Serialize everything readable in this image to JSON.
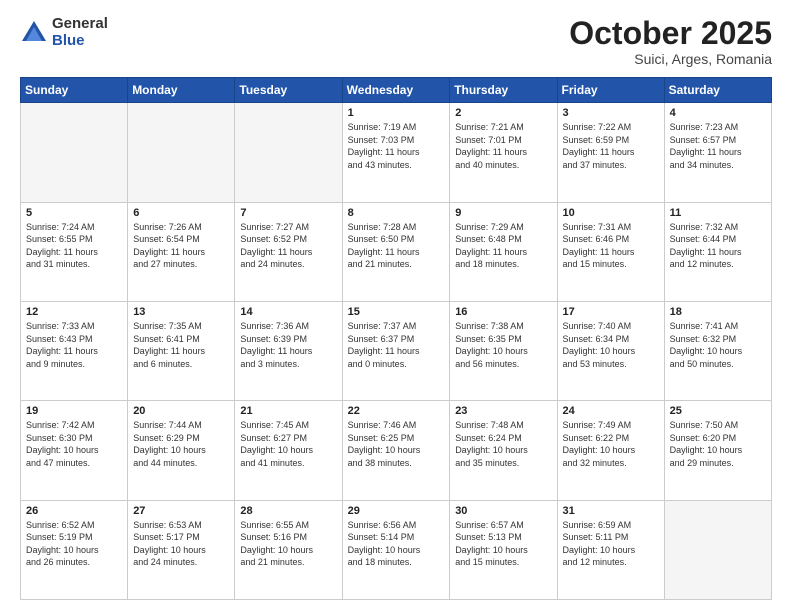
{
  "header": {
    "logo_general": "General",
    "logo_blue": "Blue",
    "month_title": "October 2025",
    "subtitle": "Suici, Arges, Romania"
  },
  "weekdays": [
    "Sunday",
    "Monday",
    "Tuesday",
    "Wednesday",
    "Thursday",
    "Friday",
    "Saturday"
  ],
  "weeks": [
    [
      {
        "day": "",
        "detail": ""
      },
      {
        "day": "",
        "detail": ""
      },
      {
        "day": "",
        "detail": ""
      },
      {
        "day": "1",
        "detail": "Sunrise: 7:19 AM\nSunset: 7:03 PM\nDaylight: 11 hours\nand 43 minutes."
      },
      {
        "day": "2",
        "detail": "Sunrise: 7:21 AM\nSunset: 7:01 PM\nDaylight: 11 hours\nand 40 minutes."
      },
      {
        "day": "3",
        "detail": "Sunrise: 7:22 AM\nSunset: 6:59 PM\nDaylight: 11 hours\nand 37 minutes."
      },
      {
        "day": "4",
        "detail": "Sunrise: 7:23 AM\nSunset: 6:57 PM\nDaylight: 11 hours\nand 34 minutes."
      }
    ],
    [
      {
        "day": "5",
        "detail": "Sunrise: 7:24 AM\nSunset: 6:55 PM\nDaylight: 11 hours\nand 31 minutes."
      },
      {
        "day": "6",
        "detail": "Sunrise: 7:26 AM\nSunset: 6:54 PM\nDaylight: 11 hours\nand 27 minutes."
      },
      {
        "day": "7",
        "detail": "Sunrise: 7:27 AM\nSunset: 6:52 PM\nDaylight: 11 hours\nand 24 minutes."
      },
      {
        "day": "8",
        "detail": "Sunrise: 7:28 AM\nSunset: 6:50 PM\nDaylight: 11 hours\nand 21 minutes."
      },
      {
        "day": "9",
        "detail": "Sunrise: 7:29 AM\nSunset: 6:48 PM\nDaylight: 11 hours\nand 18 minutes."
      },
      {
        "day": "10",
        "detail": "Sunrise: 7:31 AM\nSunset: 6:46 PM\nDaylight: 11 hours\nand 15 minutes."
      },
      {
        "day": "11",
        "detail": "Sunrise: 7:32 AM\nSunset: 6:44 PM\nDaylight: 11 hours\nand 12 minutes."
      }
    ],
    [
      {
        "day": "12",
        "detail": "Sunrise: 7:33 AM\nSunset: 6:43 PM\nDaylight: 11 hours\nand 9 minutes."
      },
      {
        "day": "13",
        "detail": "Sunrise: 7:35 AM\nSunset: 6:41 PM\nDaylight: 11 hours\nand 6 minutes."
      },
      {
        "day": "14",
        "detail": "Sunrise: 7:36 AM\nSunset: 6:39 PM\nDaylight: 11 hours\nand 3 minutes."
      },
      {
        "day": "15",
        "detail": "Sunrise: 7:37 AM\nSunset: 6:37 PM\nDaylight: 11 hours\nand 0 minutes."
      },
      {
        "day": "16",
        "detail": "Sunrise: 7:38 AM\nSunset: 6:35 PM\nDaylight: 10 hours\nand 56 minutes."
      },
      {
        "day": "17",
        "detail": "Sunrise: 7:40 AM\nSunset: 6:34 PM\nDaylight: 10 hours\nand 53 minutes."
      },
      {
        "day": "18",
        "detail": "Sunrise: 7:41 AM\nSunset: 6:32 PM\nDaylight: 10 hours\nand 50 minutes."
      }
    ],
    [
      {
        "day": "19",
        "detail": "Sunrise: 7:42 AM\nSunset: 6:30 PM\nDaylight: 10 hours\nand 47 minutes."
      },
      {
        "day": "20",
        "detail": "Sunrise: 7:44 AM\nSunset: 6:29 PM\nDaylight: 10 hours\nand 44 minutes."
      },
      {
        "day": "21",
        "detail": "Sunrise: 7:45 AM\nSunset: 6:27 PM\nDaylight: 10 hours\nand 41 minutes."
      },
      {
        "day": "22",
        "detail": "Sunrise: 7:46 AM\nSunset: 6:25 PM\nDaylight: 10 hours\nand 38 minutes."
      },
      {
        "day": "23",
        "detail": "Sunrise: 7:48 AM\nSunset: 6:24 PM\nDaylight: 10 hours\nand 35 minutes."
      },
      {
        "day": "24",
        "detail": "Sunrise: 7:49 AM\nSunset: 6:22 PM\nDaylight: 10 hours\nand 32 minutes."
      },
      {
        "day": "25",
        "detail": "Sunrise: 7:50 AM\nSunset: 6:20 PM\nDaylight: 10 hours\nand 29 minutes."
      }
    ],
    [
      {
        "day": "26",
        "detail": "Sunrise: 6:52 AM\nSunset: 5:19 PM\nDaylight: 10 hours\nand 26 minutes."
      },
      {
        "day": "27",
        "detail": "Sunrise: 6:53 AM\nSunset: 5:17 PM\nDaylight: 10 hours\nand 24 minutes."
      },
      {
        "day": "28",
        "detail": "Sunrise: 6:55 AM\nSunset: 5:16 PM\nDaylight: 10 hours\nand 21 minutes."
      },
      {
        "day": "29",
        "detail": "Sunrise: 6:56 AM\nSunset: 5:14 PM\nDaylight: 10 hours\nand 18 minutes."
      },
      {
        "day": "30",
        "detail": "Sunrise: 6:57 AM\nSunset: 5:13 PM\nDaylight: 10 hours\nand 15 minutes."
      },
      {
        "day": "31",
        "detail": "Sunrise: 6:59 AM\nSunset: 5:11 PM\nDaylight: 10 hours\nand 12 minutes."
      },
      {
        "day": "",
        "detail": ""
      }
    ]
  ]
}
